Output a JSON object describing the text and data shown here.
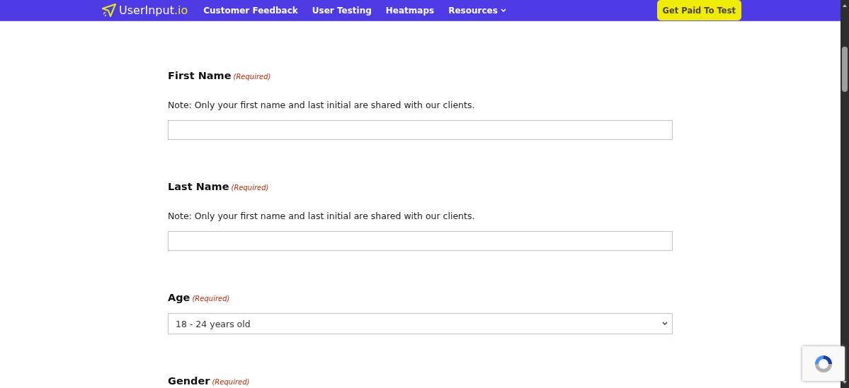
{
  "header": {
    "logo": {
      "name": "UserInput",
      "suffix": ".io"
    },
    "nav": [
      {
        "label": "Customer Feedback",
        "has_menu": false
      },
      {
        "label": "User Testing",
        "has_menu": false
      },
      {
        "label": "Heatmaps",
        "has_menu": false
      },
      {
        "label": "Resources",
        "has_menu": true
      }
    ],
    "cta": "Get Paid To Test"
  },
  "form": {
    "fields": [
      {
        "kind": "text",
        "label": "First Name",
        "required": "(Required)",
        "note": "Note: Only your first name and last initial are shared with our clients."
      },
      {
        "kind": "text",
        "label": "Last Name",
        "required": "(Required)",
        "note": "Note: Only your first name and last initial are shared with our clients."
      },
      {
        "kind": "select",
        "label": "Age",
        "required": "(Required)",
        "value": "18 - 24 years old"
      },
      {
        "kind": "heading",
        "label": "Gender",
        "required": "(Required)"
      }
    ]
  }
}
